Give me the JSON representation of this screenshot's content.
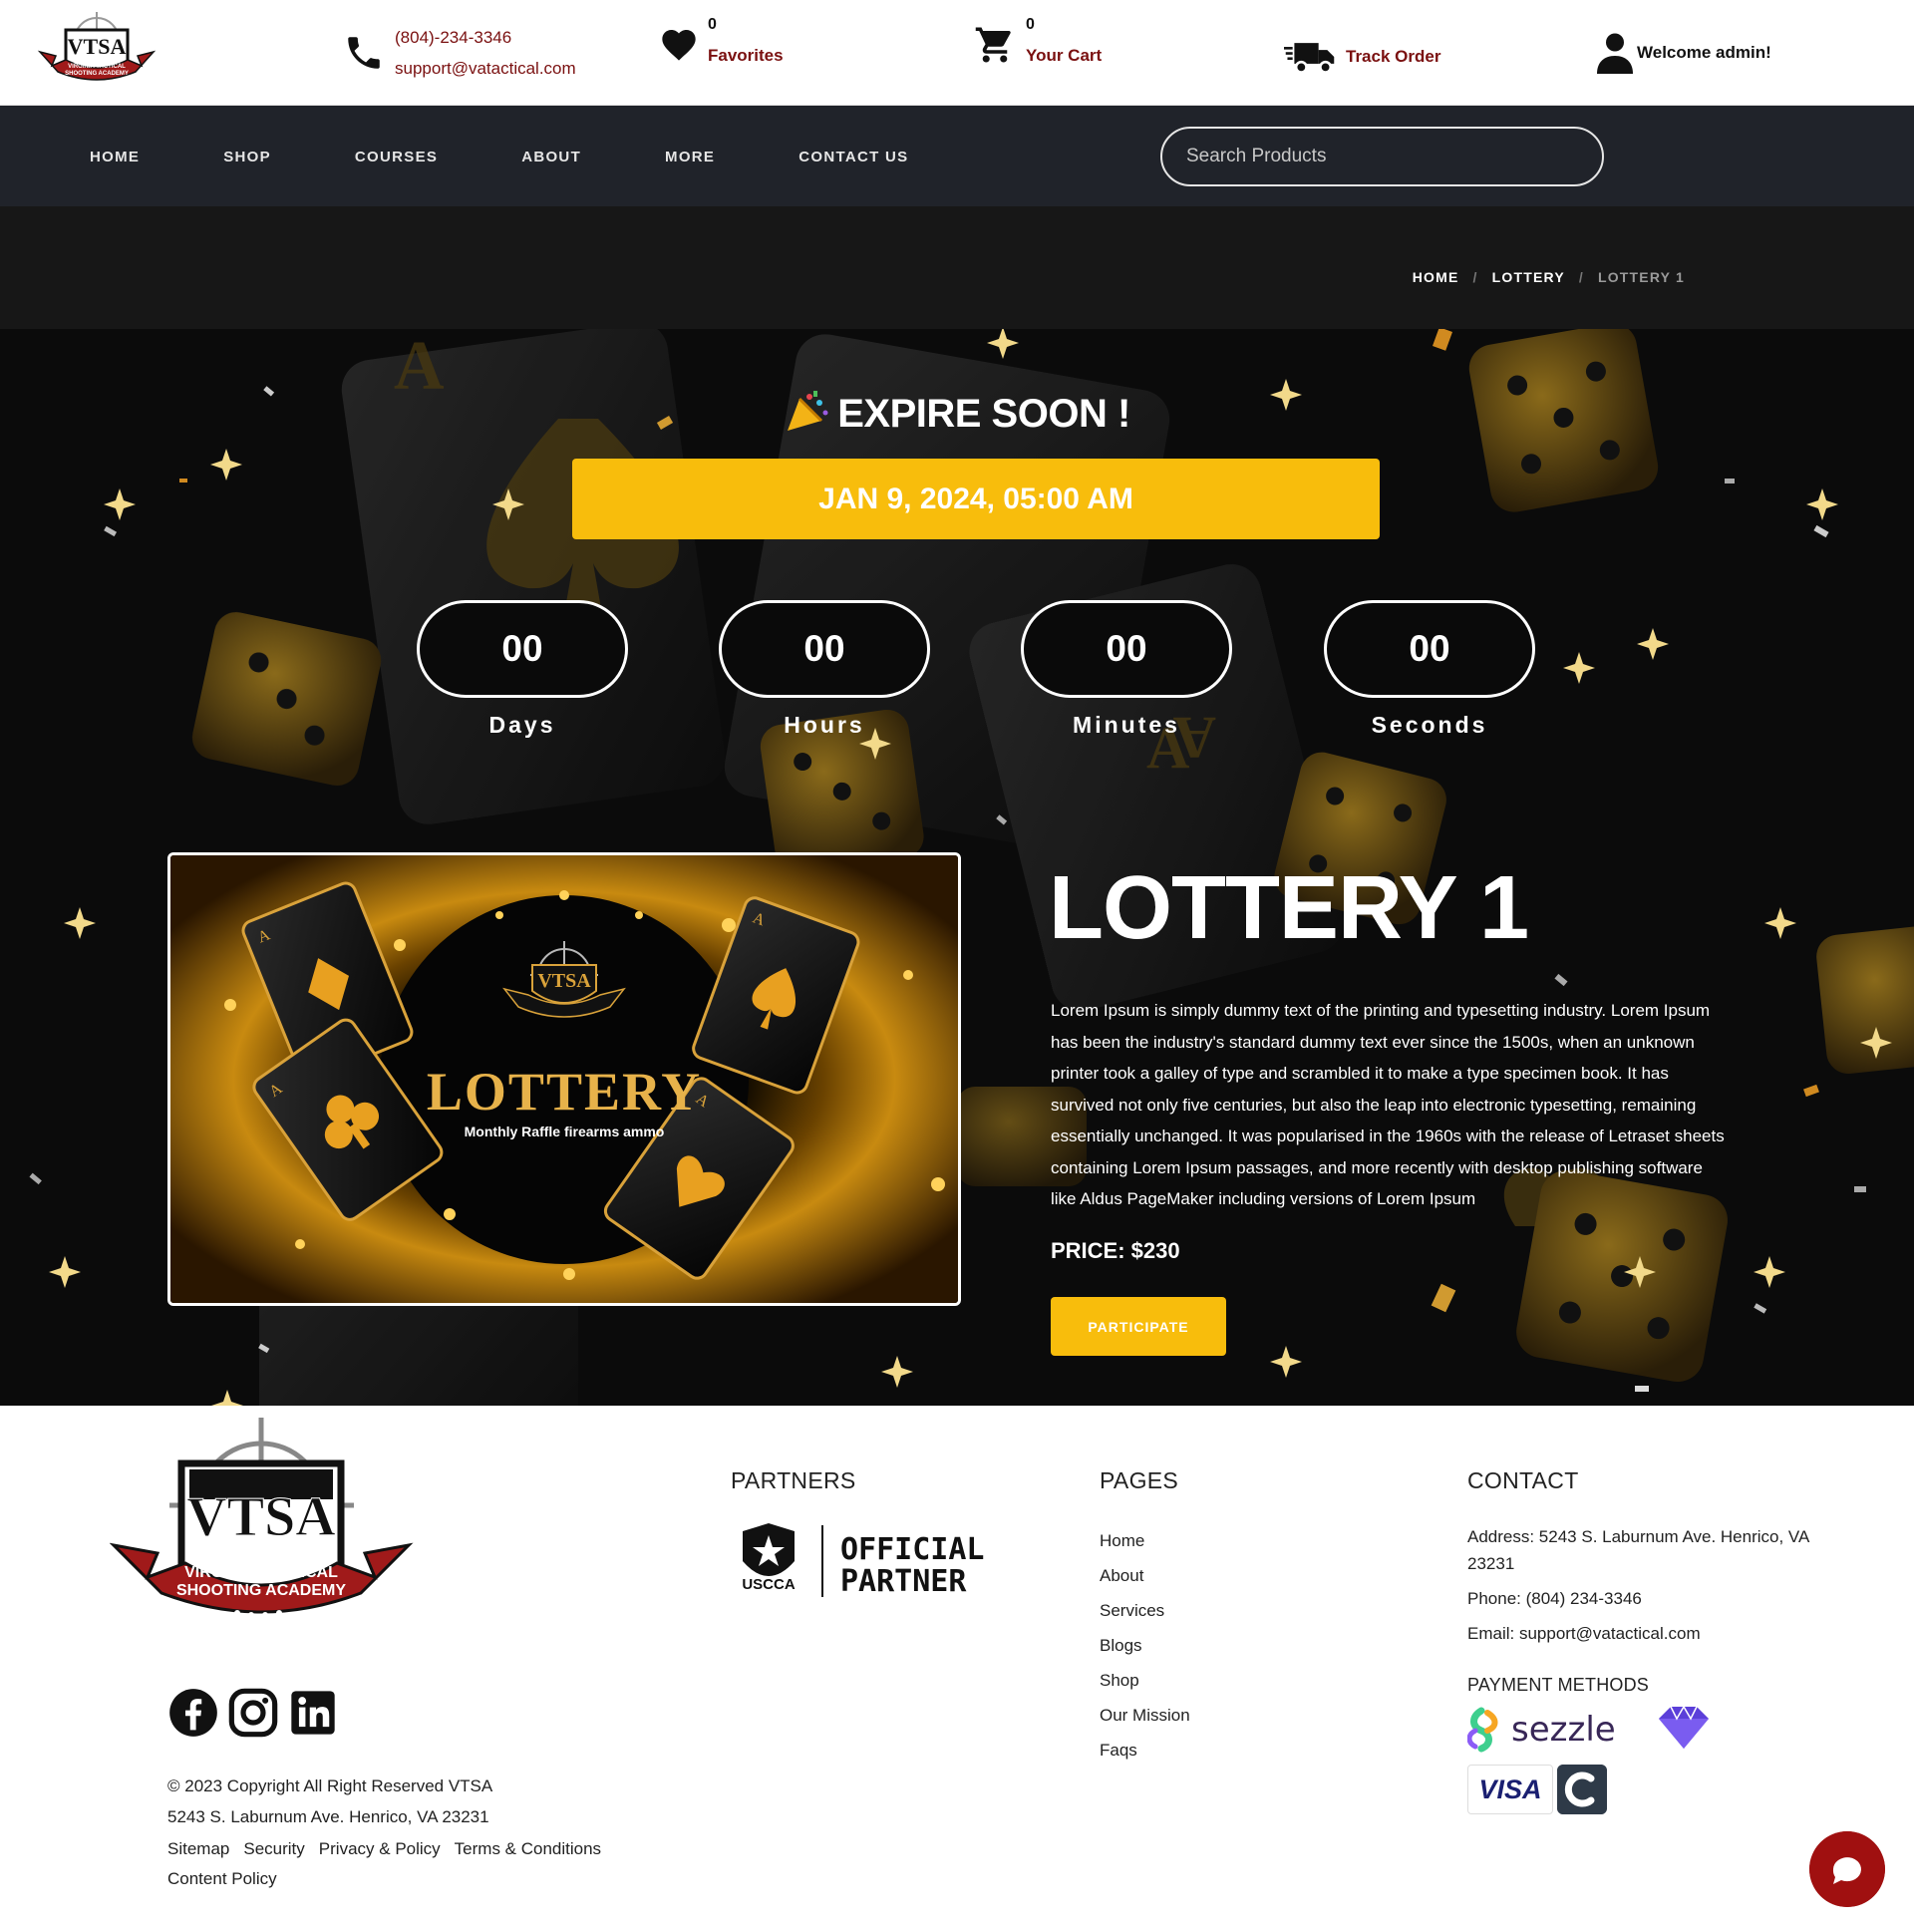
{
  "header": {
    "logo_text": "VTSA",
    "logo_subtext": "VIRGINIA TACTICAL SHOOTING ACADEMY",
    "phone": "(804)-234-3346",
    "email": "support@vatactical.com",
    "favorites_count": "0",
    "favorites_label": "Favorites",
    "cart_count": "0",
    "cart_label": "Your Cart",
    "track_label": "Track Order",
    "welcome_label": "Welcome admin!",
    "icons": {
      "phone": "phone-icon",
      "favorites": "heart-icon",
      "cart": "cart-icon",
      "track": "delivery-truck-icon",
      "user": "user-icon"
    },
    "accent_color": "#7a1010"
  },
  "nav": {
    "items": [
      "HOME",
      "SHOP",
      "COURSES",
      "ABOUT",
      "MORE",
      "CONTACT US"
    ],
    "search_placeholder": "Search Products"
  },
  "breadcrumb": [
    "HOME",
    "LOTTERY",
    "LOTTERY 1"
  ],
  "hero": {
    "expire_label": "EXPIRE SOON !",
    "expire_date": "JAN 9, 2024, 05:00 AM",
    "countdown": [
      {
        "value": "00",
        "label": "Days"
      },
      {
        "value": "00",
        "label": "Hours"
      },
      {
        "value": "00",
        "label": "Minutes"
      },
      {
        "value": "00",
        "label": "Seconds"
      }
    ],
    "image": {
      "title": "LOTTERY",
      "subtitle": "Monthly Raffle firearms ammo",
      "logo_text": "VTSA"
    },
    "lottery_title": "LOTTERY 1",
    "description": "Lorem Ipsum is simply dummy text of the printing and typesetting industry. Lorem Ipsum has been the industry's standard dummy text ever since the 1500s, when an unknown printer took a galley of type and scrambled it to make a type specimen book. It has survived not only five centuries, but also the leap into electronic typesetting, remaining essentially unchanged. It was popularised in the 1960s with the release of Letraset sheets containing Lorem Ipsum passages, and more recently with desktop publishing software like Aldus PageMaker including versions of Lorem Ipsum",
    "price": "PRICE: $230",
    "participate_label": "PARTICIPATE",
    "accent_color": "#f8bd0c"
  },
  "footer": {
    "logo_text": "VTSA",
    "logo_subtext_1": "VIRGINIA TACTICAL",
    "logo_subtext_2": "SHOOTING ACADEMY",
    "social": [
      "facebook-icon",
      "instagram-icon",
      "linkedin-icon"
    ],
    "copyright": "© 2023 Copyright All Right Reserved VTSA",
    "address_line": "5243 S. Laburnum Ave. Henrico, VA 23231",
    "links": [
      "Sitemap",
      "Security",
      "Privacy & Policy",
      "Terms & Conditions"
    ],
    "content_policy": "Content Policy",
    "partners_heading": "PARTNERS",
    "uscca_text": "USCCA",
    "official_1": "OFFICIAL",
    "official_2": "PARTNER",
    "pages_heading": "PAGES",
    "pages": [
      "Home",
      "About",
      "Services",
      "Blogs",
      "Shop",
      "Our Mission",
      "Faqs"
    ],
    "contact_heading": "CONTACT",
    "address": "Address: 5243 S. Laburnum Ave. Henrico, VA 23231",
    "phone": "Phone: (804) 234-3346",
    "email": "Email: support@vatactical.com",
    "payment_heading": "PAYMENT METHODS",
    "sezzle": "sezzle",
    "visa": "VISA",
    "chat_icon": "chat-bubble-icon"
  }
}
